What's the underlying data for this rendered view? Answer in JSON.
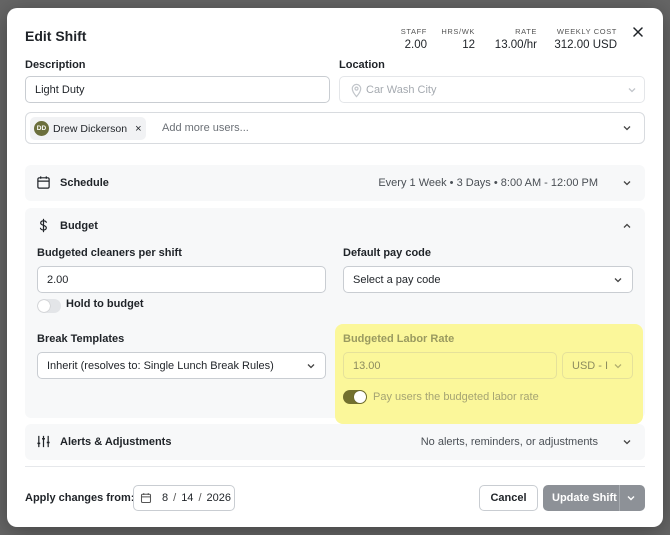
{
  "modal": {
    "title": "Edit Shift",
    "stats": [
      {
        "key": "STAFF",
        "value": "2.00"
      },
      {
        "key": "HRS/WK",
        "value": "12"
      },
      {
        "key": "RATE",
        "value": "13.00/hr"
      },
      {
        "key": "WEEKLY COST",
        "value": "312.00 USD"
      }
    ]
  },
  "description": {
    "label": "Description",
    "value": "Light Duty"
  },
  "location": {
    "label": "Location",
    "placeholder": "Car Wash City"
  },
  "users": {
    "chips": [
      {
        "initials": "DD",
        "name": "Drew Dickerson"
      }
    ],
    "placeholder": "Add more users..."
  },
  "schedule": {
    "title": "Schedule",
    "summary": "Every 1 Week • 3 Days • 8:00 AM - 12:00 PM"
  },
  "budget": {
    "title": "Budget",
    "cleaners_label": "Budgeted cleaners per shift",
    "cleaners_value": "2.00",
    "hold_label": "Hold to budget",
    "hold_on": false,
    "paycode_label": "Default pay code",
    "paycode_value": "Select a pay code",
    "break_label": "Break Templates",
    "break_value": "Inherit (resolves to: Single Lunch Break Rules)",
    "labor_rate_label": "Budgeted Labor Rate",
    "labor_rate_value": "13.00",
    "currency_value": "USD - I",
    "pay_budgeted_label": "Pay users the budgeted labor rate",
    "pay_budgeted_on": true
  },
  "alerts": {
    "title": "Alerts & Adjustments",
    "summary": "No alerts, reminders, or adjustments"
  },
  "footer": {
    "apply_label": "Apply changes from:",
    "date_month": "8",
    "date_day": "14",
    "date_year": "2026",
    "date_sep": "/",
    "cancel_label": "Cancel",
    "update_label": "Update Shift"
  },
  "colors": {
    "highlight": "#fbf79a",
    "toggle_on": "#72702f",
    "primary_disabled": "#8d9197"
  }
}
